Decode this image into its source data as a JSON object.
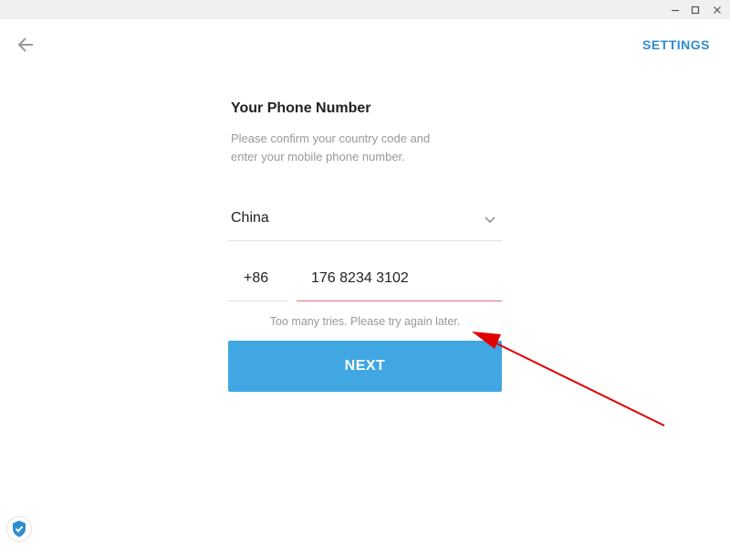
{
  "window": {
    "controls": [
      "minimize-icon",
      "maximize-icon",
      "close-icon"
    ]
  },
  "header": {
    "back_icon": "arrow-left-icon",
    "settings_label": "SETTINGS"
  },
  "form": {
    "title": "Your Phone Number",
    "description_line1": "Please confirm your country code and",
    "description_line2": "enter your mobile phone number.",
    "country": "China",
    "country_icon": "chevron-down-icon",
    "country_code": "+86",
    "phone_number": "176 8234 3102",
    "error": "Too many tries. Please try again later.",
    "next_label": "NEXT"
  },
  "colors": {
    "accent": "#40a7e3",
    "link": "#2f8ccf",
    "error_underline": "#e07070",
    "annotation": "#e00000"
  },
  "badge": {
    "icon": "shield-check-icon"
  }
}
